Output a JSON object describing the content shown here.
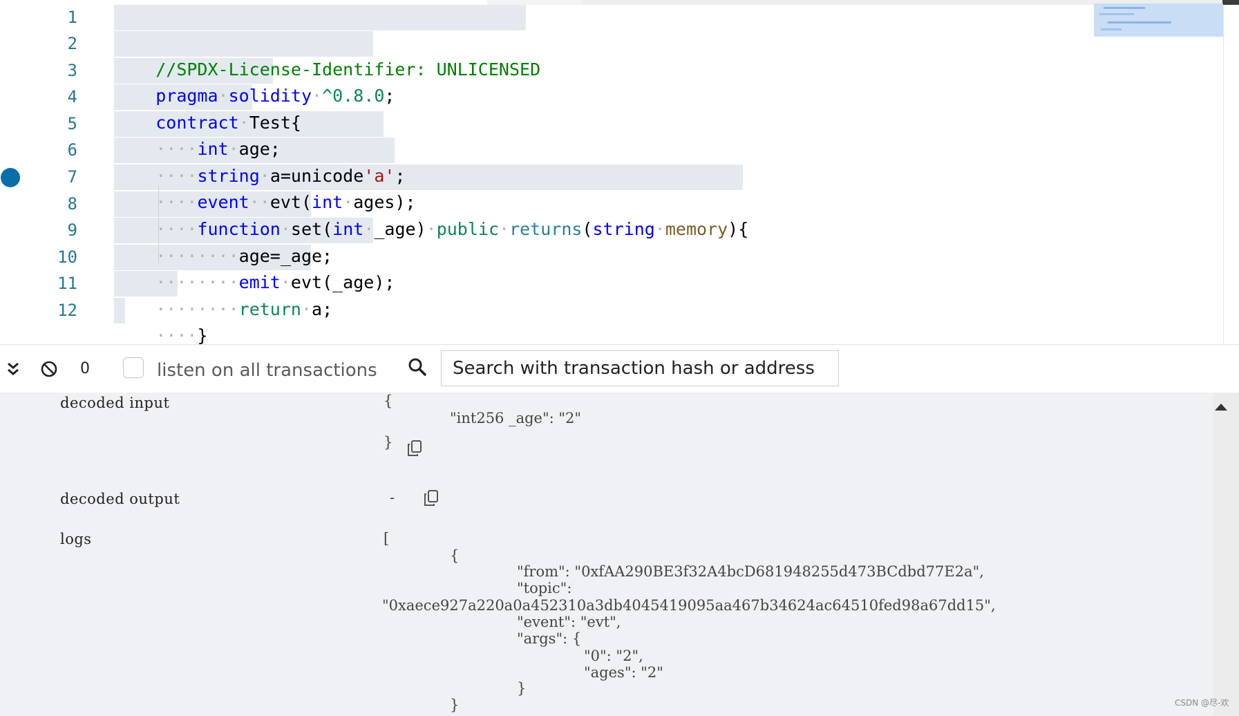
{
  "editor": {
    "line_numbers": [
      "1",
      "2",
      "3",
      "4",
      "5",
      "6",
      "7",
      "8",
      "9",
      "10",
      "11",
      "12"
    ],
    "code": {
      "l1": "//SPDX-License-Identifier: UNLICENSED",
      "l2_kw": "pragma",
      "l2_kw2": "solidity",
      "l2_ver": "^0.8.0",
      "l2_end": ";",
      "l3_kw": "contract",
      "l3_name": "Test{",
      "l4_type": "int",
      "l4_rest": "age;",
      "l5_type": "string",
      "l5_rest": "a=unicode",
      "l5_str": "'a'",
      "l5_end": ";",
      "l6_kw": "event",
      "l6_name": "evt(",
      "l6_type": "int",
      "l6_rest": "ages);",
      "l7_kw": "function",
      "l7_name": "set(",
      "l7_type": "int",
      "l7_param": "_age)",
      "l7_public": "public",
      "l7_returns": "returns",
      "l7_paren": "(",
      "l7_string": "string",
      "l7_memory": "memory",
      "l7_end": "){",
      "l8": "age=_age;",
      "l9_kw": "emit",
      "l9_rest": "evt(_age);",
      "l10_kw": "return",
      "l10_rest": "a;",
      "l11": "}",
      "l12": "}"
    }
  },
  "toolbar": {
    "count": "0",
    "listen_label": "listen on all transactions",
    "search_placeholder": "Search with transaction hash or address"
  },
  "output": {
    "decoded_input_label": "decoded input",
    "decoded_input_open": "{",
    "decoded_input_line": "\"int256 _age\": \"2\"",
    "decoded_input_close": "}",
    "decoded_output_label": "decoded output",
    "decoded_output_value": "-",
    "logs_label": "logs",
    "logs_lines": [
      "[",
      "{",
      "\"from\": \"0xfAA290BE3f32A4bcD681948255d473BCdbd77E2a\",",
      "\"topic\":",
      "\"0xaece927a220a0a452310a3db4045419095aa467b34624ac64510fed98a67dd15\",",
      "\"event\": \"evt\",",
      "\"args\": {",
      "\"0\": \"2\",",
      "\"ages\": \"2\"",
      "}",
      "}"
    ]
  },
  "watermark": "CSDN @尽-欢"
}
